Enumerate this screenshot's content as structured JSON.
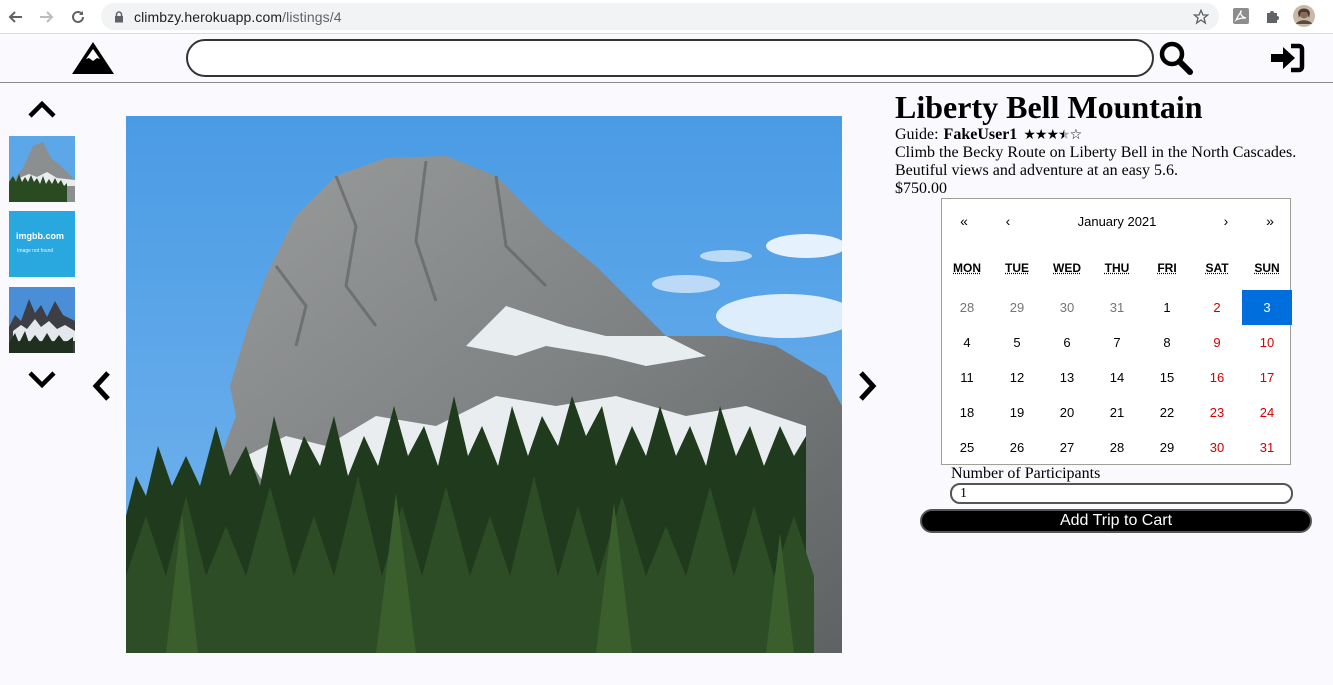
{
  "browser": {
    "url_host": "climbzy.herokuapp.com",
    "url_path": "/listings/4"
  },
  "header": {
    "search_value": ""
  },
  "thumbnails": [
    {
      "type": "photo"
    },
    {
      "type": "placeholder",
      "title": "imgbb.com",
      "subtitle": "Image not found"
    },
    {
      "type": "photo"
    }
  ],
  "listing": {
    "title": "Liberty Bell Mountain",
    "guide_prefix": "Guide:",
    "guide_name": "FakeUser1",
    "rating": 3.5,
    "rating_max": 5,
    "description": "Climb the Becky Route on Liberty Bell in the North Cascades. Beutiful views and adventure at an easy 5.6.",
    "price": "$750.00"
  },
  "calendar": {
    "prev2": "«",
    "prev": "‹",
    "label": "January 2021",
    "next": "›",
    "next2": "»",
    "weekdays": [
      "MON",
      "TUE",
      "WED",
      "THU",
      "FRI",
      "SAT",
      "SUN"
    ],
    "days": [
      {
        "d": "28",
        "neighbor": true,
        "weekend": false
      },
      {
        "d": "29",
        "neighbor": true,
        "weekend": false
      },
      {
        "d": "30",
        "neighbor": true,
        "weekend": false
      },
      {
        "d": "31",
        "neighbor": true,
        "weekend": false
      },
      {
        "d": "1",
        "neighbor": false,
        "weekend": false
      },
      {
        "d": "2",
        "neighbor": false,
        "weekend": true
      },
      {
        "d": "3",
        "neighbor": false,
        "weekend": true,
        "selected": true
      },
      {
        "d": "4",
        "neighbor": false,
        "weekend": false
      },
      {
        "d": "5",
        "neighbor": false,
        "weekend": false
      },
      {
        "d": "6",
        "neighbor": false,
        "weekend": false
      },
      {
        "d": "7",
        "neighbor": false,
        "weekend": false
      },
      {
        "d": "8",
        "neighbor": false,
        "weekend": false
      },
      {
        "d": "9",
        "neighbor": false,
        "weekend": true
      },
      {
        "d": "10",
        "neighbor": false,
        "weekend": true
      },
      {
        "d": "11",
        "neighbor": false,
        "weekend": false
      },
      {
        "d": "12",
        "neighbor": false,
        "weekend": false
      },
      {
        "d": "13",
        "neighbor": false,
        "weekend": false
      },
      {
        "d": "14",
        "neighbor": false,
        "weekend": false
      },
      {
        "d": "15",
        "neighbor": false,
        "weekend": false
      },
      {
        "d": "16",
        "neighbor": false,
        "weekend": true
      },
      {
        "d": "17",
        "neighbor": false,
        "weekend": true
      },
      {
        "d": "18",
        "neighbor": false,
        "weekend": false
      },
      {
        "d": "19",
        "neighbor": false,
        "weekend": false
      },
      {
        "d": "20",
        "neighbor": false,
        "weekend": false
      },
      {
        "d": "21",
        "neighbor": false,
        "weekend": false
      },
      {
        "d": "22",
        "neighbor": false,
        "weekend": false
      },
      {
        "d": "23",
        "neighbor": false,
        "weekend": true
      },
      {
        "d": "24",
        "neighbor": false,
        "weekend": true
      },
      {
        "d": "25",
        "neighbor": false,
        "weekend": false
      },
      {
        "d": "26",
        "neighbor": false,
        "weekend": false
      },
      {
        "d": "27",
        "neighbor": false,
        "weekend": false
      },
      {
        "d": "28",
        "neighbor": false,
        "weekend": false
      },
      {
        "d": "29",
        "neighbor": false,
        "weekend": false
      },
      {
        "d": "30",
        "neighbor": false,
        "weekend": true
      },
      {
        "d": "31",
        "neighbor": false,
        "weekend": true
      }
    ]
  },
  "booking": {
    "participants_label": "Number of Participants",
    "participants_value": "1",
    "cart_button": "Add Trip to Cart"
  },
  "colors": {
    "selected_day": "#006edc",
    "weekend_day": "#d10000",
    "sky": "#4c9ee6"
  },
  "icons": [
    "back-arrow-icon",
    "forward-arrow-icon",
    "reload-icon",
    "lock-icon",
    "star-bookmark-icon",
    "pdf-extension-icon",
    "puzzle-extensions-icon",
    "profile-avatar",
    "mountain-logo-icon",
    "magnifier-search-icon",
    "sign-in-icon",
    "chevron-up-icon",
    "chevron-down-icon",
    "chevron-left-icon",
    "chevron-right-icon"
  ]
}
